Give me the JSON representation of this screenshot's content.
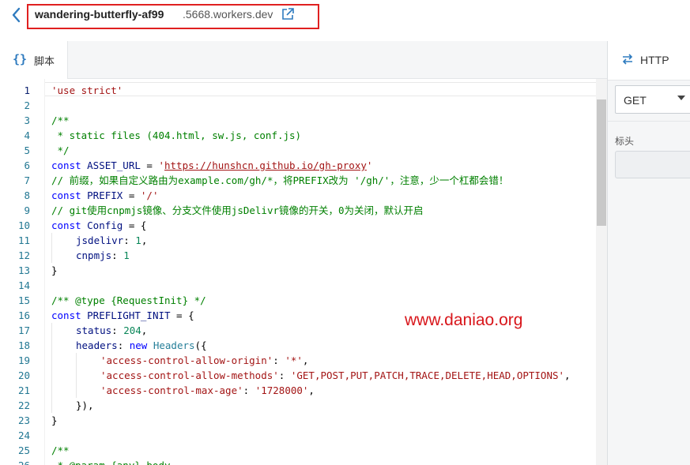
{
  "header": {
    "back_icon": "chevron-left-icon",
    "worker_name": "wandering-butterfly-af99",
    "domain_suffix": ".5668.workers.dev",
    "open_icon": "external-link-icon",
    "highlight_color": "#e02020"
  },
  "tabs": {
    "script_icon": "{}",
    "script_label": "脚本",
    "http_label": "HTTP",
    "http_icon": "swap-arrows-icon"
  },
  "editor": {
    "lines": [
      {
        "n": "1",
        "indent": 0,
        "tokens": [
          {
            "c": "str",
            "t": "'use strict'"
          }
        ]
      },
      {
        "n": "2",
        "indent": 0,
        "tokens": []
      },
      {
        "n": "3",
        "indent": 0,
        "tokens": [
          {
            "c": "cmt",
            "t": "/**"
          }
        ]
      },
      {
        "n": "4",
        "indent": 0,
        "tokens": [
          {
            "c": "cmt",
            "t": " * static files (404.html, sw.js, conf.js)"
          }
        ]
      },
      {
        "n": "5",
        "indent": 0,
        "tokens": [
          {
            "c": "cmt",
            "t": " */"
          }
        ]
      },
      {
        "n": "6",
        "indent": 0,
        "tokens": [
          {
            "c": "kw",
            "t": "const "
          },
          {
            "c": "id",
            "t": "ASSET_URL"
          },
          {
            "c": "p",
            "t": " = "
          },
          {
            "c": "str",
            "t": "'"
          },
          {
            "c": "url",
            "t": "https://hunshcn.github.io/gh-proxy"
          },
          {
            "c": "str",
            "t": "'"
          }
        ]
      },
      {
        "n": "7",
        "indent": 0,
        "tokens": [
          {
            "c": "cmt",
            "t": "// 前缀，如果自定义路由为example.com/gh/*，将PREFIX改为 '/gh/'，注意，少一个杠都会错！"
          }
        ]
      },
      {
        "n": "8",
        "indent": 0,
        "tokens": [
          {
            "c": "kw",
            "t": "const "
          },
          {
            "c": "id",
            "t": "PREFIX"
          },
          {
            "c": "p",
            "t": " = "
          },
          {
            "c": "str",
            "t": "'/'"
          }
        ]
      },
      {
        "n": "9",
        "indent": 0,
        "tokens": [
          {
            "c": "cmt",
            "t": "// git使用cnpmjs镜像、分支文件使用jsDelivr镜像的开关，0为关闭，默认开启"
          }
        ]
      },
      {
        "n": "10",
        "indent": 0,
        "tokens": [
          {
            "c": "kw",
            "t": "const "
          },
          {
            "c": "id",
            "t": "Config"
          },
          {
            "c": "p",
            "t": " = {"
          }
        ]
      },
      {
        "n": "11",
        "indent": 1,
        "tokens": [
          {
            "c": "id",
            "t": "jsdelivr"
          },
          {
            "c": "p",
            "t": ": "
          },
          {
            "c": "num",
            "t": "1"
          },
          {
            "c": "p",
            "t": ","
          }
        ]
      },
      {
        "n": "12",
        "indent": 1,
        "tokens": [
          {
            "c": "id",
            "t": "cnpmjs"
          },
          {
            "c": "p",
            "t": ": "
          },
          {
            "c": "num",
            "t": "1"
          }
        ]
      },
      {
        "n": "13",
        "indent": 0,
        "tokens": [
          {
            "c": "p",
            "t": "}"
          }
        ]
      },
      {
        "n": "14",
        "indent": 0,
        "tokens": []
      },
      {
        "n": "15",
        "indent": 0,
        "tokens": [
          {
            "c": "cmt",
            "t": "/** @type {RequestInit} */"
          }
        ]
      },
      {
        "n": "16",
        "indent": 0,
        "tokens": [
          {
            "c": "kw",
            "t": "const "
          },
          {
            "c": "id",
            "t": "PREFLIGHT_INIT"
          },
          {
            "c": "p",
            "t": " = {"
          }
        ]
      },
      {
        "n": "17",
        "indent": 1,
        "tokens": [
          {
            "c": "id",
            "t": "status"
          },
          {
            "c": "p",
            "t": ": "
          },
          {
            "c": "num",
            "t": "204"
          },
          {
            "c": "p",
            "t": ","
          }
        ]
      },
      {
        "n": "18",
        "indent": 1,
        "tokens": [
          {
            "c": "id",
            "t": "headers"
          },
          {
            "c": "p",
            "t": ": "
          },
          {
            "c": "kw",
            "t": "new "
          },
          {
            "c": "fn",
            "t": "Headers"
          },
          {
            "c": "p",
            "t": "({"
          }
        ]
      },
      {
        "n": "19",
        "indent": 2,
        "tokens": [
          {
            "c": "str",
            "t": "'access-control-allow-origin'"
          },
          {
            "c": "p",
            "t": ": "
          },
          {
            "c": "str",
            "t": "'*'"
          },
          {
            "c": "p",
            "t": ","
          }
        ]
      },
      {
        "n": "20",
        "indent": 2,
        "tokens": [
          {
            "c": "str",
            "t": "'access-control-allow-methods'"
          },
          {
            "c": "p",
            "t": ": "
          },
          {
            "c": "str",
            "t": "'GET,POST,PUT,PATCH,TRACE,DELETE,HEAD,OPTIONS'"
          },
          {
            "c": "p",
            "t": ","
          }
        ]
      },
      {
        "n": "21",
        "indent": 2,
        "tokens": [
          {
            "c": "str",
            "t": "'access-control-max-age'"
          },
          {
            "c": "p",
            "t": ": "
          },
          {
            "c": "str",
            "t": "'1728000'"
          },
          {
            "c": "p",
            "t": ","
          }
        ]
      },
      {
        "n": "22",
        "indent": 1,
        "tokens": [
          {
            "c": "p",
            "t": "}),"
          }
        ]
      },
      {
        "n": "23",
        "indent": 0,
        "tokens": [
          {
            "c": "p",
            "t": "}"
          }
        ]
      },
      {
        "n": "24",
        "indent": 0,
        "tokens": []
      },
      {
        "n": "25",
        "indent": 0,
        "tokens": [
          {
            "c": "cmt",
            "t": "/**"
          }
        ]
      },
      {
        "n": "26",
        "indent": 0,
        "tokens": [
          {
            "c": "cmt",
            "t": " * @param {any} body"
          }
        ]
      }
    ]
  },
  "watermark": "www.daniao.org",
  "right_panel": {
    "method_value": "GET",
    "headers_label": "标头",
    "headers_placeholder": ""
  }
}
